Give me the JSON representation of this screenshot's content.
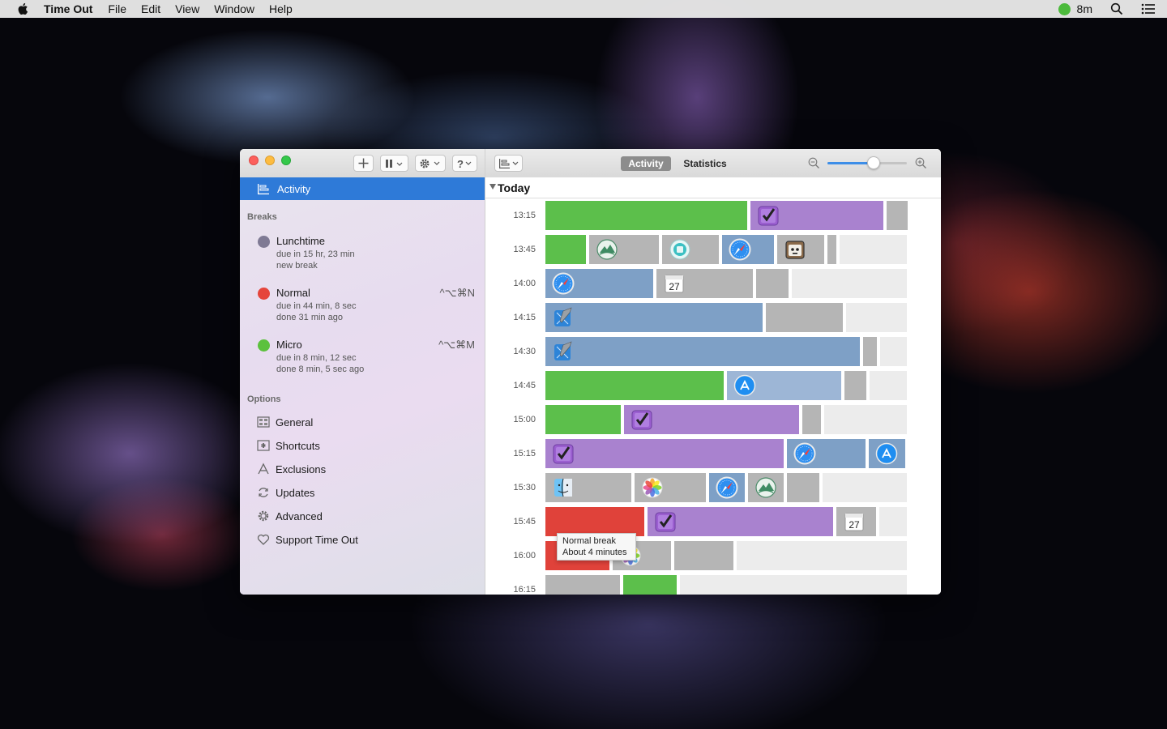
{
  "menubar": {
    "app_name": "Time Out",
    "menus": [
      "File",
      "Edit",
      "View",
      "Window",
      "Help"
    ],
    "status_time": "8m"
  },
  "sidebar": {
    "activity_label": "Activity",
    "breaks_header": "Breaks",
    "breaks": [
      {
        "name": "Lunchtime",
        "color": "#7f7a94",
        "line1": "due in 15 hr, 23 min",
        "line2": "new break",
        "shortcut": ""
      },
      {
        "name": "Normal",
        "color": "#e5453b",
        "line1": "due in 44 min, 8 sec",
        "line2": "done 31 min ago",
        "shortcut": "^⌥⌘N"
      },
      {
        "name": "Micro",
        "color": "#5cc13d",
        "line1": "due in 8 min, 12 sec",
        "line2": "done 8 min, 5 sec ago",
        "shortcut": "^⌥⌘M"
      }
    ],
    "options_header": "Options",
    "options": [
      {
        "label": "General",
        "icon": "general-icon"
      },
      {
        "label": "Shortcuts",
        "icon": "keyboard-icon"
      },
      {
        "label": "Exclusions",
        "icon": "exclusions-icon"
      },
      {
        "label": "Updates",
        "icon": "refresh-icon"
      },
      {
        "label": "Advanced",
        "icon": "gear-icon"
      },
      {
        "label": "Support Time Out",
        "icon": "heart-icon"
      }
    ]
  },
  "toolbar": {
    "tabs": [
      "Activity",
      "Statistics"
    ],
    "selected_tab": "Activity",
    "zoom_level": 0.58
  },
  "timeline": {
    "group_label": "Today",
    "rows": [
      {
        "time": "13:15",
        "segments": [
          {
            "start": 0,
            "end": 249,
            "color": "#5cbf4b",
            "icon": null
          },
          {
            "start": 253,
            "end": 417,
            "color": "#a982cf",
            "icon": "tasks-icon"
          },
          {
            "start": 421,
            "end": 447,
            "color": "#b5b5b5",
            "icon": null
          }
        ]
      },
      {
        "time": "13:45",
        "segments": [
          {
            "start": 0,
            "end": 50,
            "color": "#5cbf4b",
            "icon": null
          },
          {
            "start": 54,
            "end": 140,
            "color": "#b5b5b5",
            "icon": "mountain-app-icon"
          },
          {
            "start": 144,
            "end": 214,
            "color": "#b5b5b5",
            "icon": "stop-app-icon"
          },
          {
            "start": 218,
            "end": 282,
            "color": "#7ea0c6",
            "icon": "safari-icon"
          },
          {
            "start": 286,
            "end": 344,
            "color": "#b5b5b5",
            "icon": "robot-app-icon"
          },
          {
            "start": 348,
            "end": 359,
            "color": "#b5b5b5",
            "icon": null
          },
          {
            "start": 363,
            "end": 446,
            "color": "#ececec",
            "icon": null
          }
        ]
      },
      {
        "time": "14:00",
        "segments": [
          {
            "start": 0,
            "end": 133,
            "color": "#7ea0c6",
            "icon": "safari-icon"
          },
          {
            "start": 137,
            "end": 256,
            "color": "#b5b5b5",
            "icon": "calendar-icon"
          },
          {
            "start": 260,
            "end": 300,
            "color": "#b5b5b5",
            "icon": null
          },
          {
            "start": 304,
            "end": 446,
            "color": "#ececec",
            "icon": null
          }
        ]
      },
      {
        "time": "14:15",
        "segments": [
          {
            "start": 0,
            "end": 268,
            "color": "#7ea0c6",
            "icon": "xcode-icon"
          },
          {
            "start": 272,
            "end": 367,
            "color": "#b5b5b5",
            "icon": null
          },
          {
            "start": 371,
            "end": 446,
            "color": "#ececec",
            "icon": null
          }
        ]
      },
      {
        "time": "14:30",
        "segments": [
          {
            "start": 0,
            "end": 388,
            "color": "#7ea0c6",
            "icon": "xcode-icon"
          },
          {
            "start": 392,
            "end": 409,
            "color": "#b5b5b5",
            "icon": null
          },
          {
            "start": 413,
            "end": 446,
            "color": "#ececec",
            "icon": null
          }
        ]
      },
      {
        "time": "14:45",
        "segments": [
          {
            "start": 0,
            "end": 220,
            "color": "#5cbf4b",
            "icon": null
          },
          {
            "start": 224,
            "end": 365,
            "color": "#9db6d6",
            "icon": "app-store-icon"
          },
          {
            "start": 369,
            "end": 396,
            "color": "#b5b5b5",
            "icon": null
          },
          {
            "start": 400,
            "end": 446,
            "color": "#ececec",
            "icon": null
          }
        ]
      },
      {
        "time": "15:00",
        "segments": [
          {
            "start": 0,
            "end": 93,
            "color": "#5cbf4b",
            "icon": null
          },
          {
            "start": 97,
            "end": 313,
            "color": "#a982cf",
            "icon": "tasks-icon"
          },
          {
            "start": 317,
            "end": 340,
            "color": "#b5b5b5",
            "icon": null
          },
          {
            "start": 344,
            "end": 446,
            "color": "#ececec",
            "icon": null
          }
        ]
      },
      {
        "time": "15:15",
        "segments": [
          {
            "start": 0,
            "end": 294,
            "color": "#a982cf",
            "icon": "tasks-icon"
          },
          {
            "start": 298,
            "end": 395,
            "color": "#7ea0c6",
            "icon": "safari-icon"
          },
          {
            "start": 399,
            "end": 444,
            "color": "#7ea0c6",
            "icon": "app-store-icon"
          }
        ]
      },
      {
        "time": "15:30",
        "segments": [
          {
            "start": 0,
            "end": 106,
            "color": "#b5b5b5",
            "icon": "finder-icon"
          },
          {
            "start": 110,
            "end": 198,
            "color": "#b5b5b5",
            "icon": "photos-icon"
          },
          {
            "start": 202,
            "end": 246,
            "color": "#7ea0c6",
            "icon": "safari-icon"
          },
          {
            "start": 250,
            "end": 294,
            "color": "#b5b5b5",
            "icon": "mountain-app-icon"
          },
          {
            "start": 298,
            "end": 338,
            "color": "#b5b5b5",
            "icon": null
          },
          {
            "start": 342,
            "end": 446,
            "color": "#ececec",
            "icon": null
          }
        ]
      },
      {
        "time": "15:45",
        "segments": [
          {
            "start": 0,
            "end": 122,
            "color": "#e0423a",
            "icon": null
          },
          {
            "start": 126,
            "end": 355,
            "color": "#a982cf",
            "icon": "tasks-icon"
          },
          {
            "start": 359,
            "end": 408,
            "color": "#b5b5b5",
            "icon": "calendar-icon"
          },
          {
            "start": 412,
            "end": 446,
            "color": "#ececec",
            "icon": null
          }
        ]
      },
      {
        "time": "16:00",
        "segments": [
          {
            "start": 0,
            "end": 79,
            "color": "#e0423a",
            "icon": null
          },
          {
            "start": 83,
            "end": 155,
            "color": "#b5b5b5",
            "icon": "photos-icon"
          },
          {
            "start": 159,
            "end": 232,
            "color": "#b5b5b5",
            "icon": null
          },
          {
            "start": 236,
            "end": 446,
            "color": "#ececec",
            "icon": null
          }
        ]
      },
      {
        "time": "16:15",
        "segments": [
          {
            "start": 0,
            "end": 92,
            "color": "#b5b5b5",
            "icon": null
          },
          {
            "start": 96,
            "end": 162,
            "color": "#5cbf4b",
            "icon": null
          },
          {
            "start": 166,
            "end": 446,
            "color": "#ececec",
            "icon": null
          }
        ]
      }
    ],
    "tooltip": {
      "line1": "Normal break",
      "line2": "About 4 minutes"
    }
  }
}
